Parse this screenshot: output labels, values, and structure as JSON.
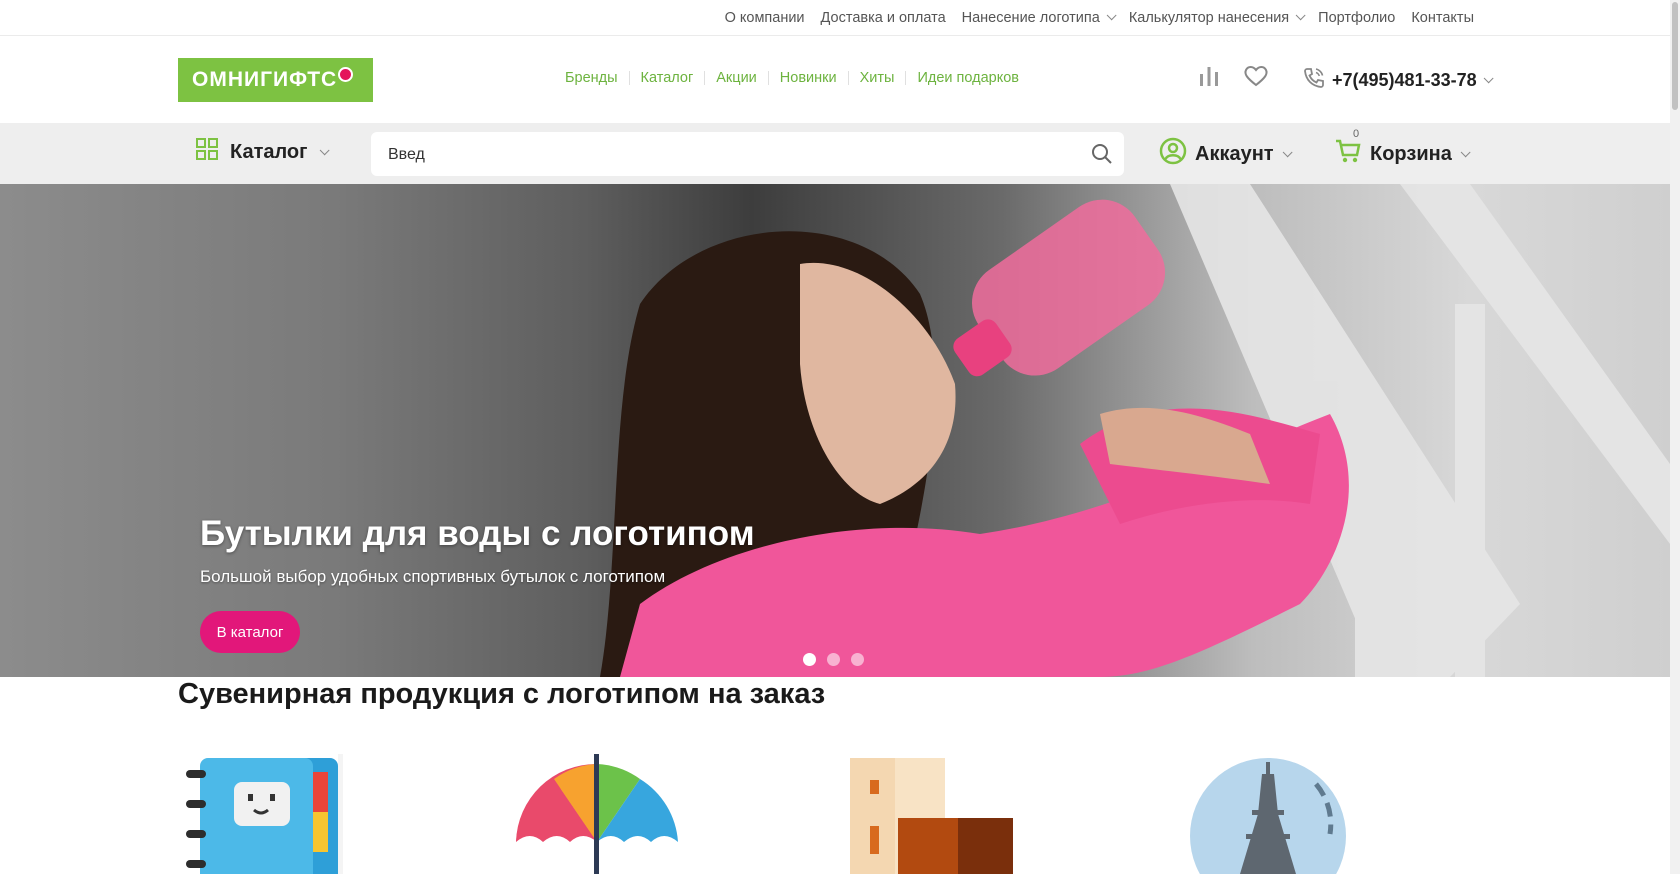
{
  "topnav": {
    "items": [
      {
        "label": "О компании",
        "dropdown": false
      },
      {
        "label": "Доставка и оплата",
        "dropdown": false
      },
      {
        "label": "Нанесение логотипа",
        "dropdown": true
      },
      {
        "label": "Калькулятор нанесения",
        "dropdown": true
      },
      {
        "label": "Портфолио",
        "dropdown": false
      },
      {
        "label": "Контакты",
        "dropdown": false
      }
    ]
  },
  "header": {
    "logo_text": "ОМНИГИФТС",
    "nav": [
      "Бренды",
      "Каталог",
      "Акции",
      "Новинки",
      "Хиты",
      "Идеи подарков"
    ],
    "phone": "+7(495)481-33-78",
    "icons": [
      "compare-icon",
      "heart-icon",
      "phone-icon"
    ]
  },
  "searchbar": {
    "catalog_label": "Каталог",
    "search_value": "Введ",
    "account_label": "Аккаунт",
    "cart_label": "Корзина",
    "cart_count": "0"
  },
  "hero": {
    "title": "Бутылки для воды с логотипом",
    "subtitle": "Большой выбор удобных спортивных бутылок с логотипом",
    "button_label": "В каталог",
    "slides": 3,
    "active_slide": 1
  },
  "section": {
    "title": "Сувенирная продукция с логотипом на заказ",
    "categories": [
      "notebook-icon",
      "umbrella-icon",
      "boxes-icon",
      "globe-icon"
    ]
  },
  "colors": {
    "brand_green": "#7dc242",
    "accent_pink": "#e2177a",
    "logo_dot": "#e4145a"
  }
}
